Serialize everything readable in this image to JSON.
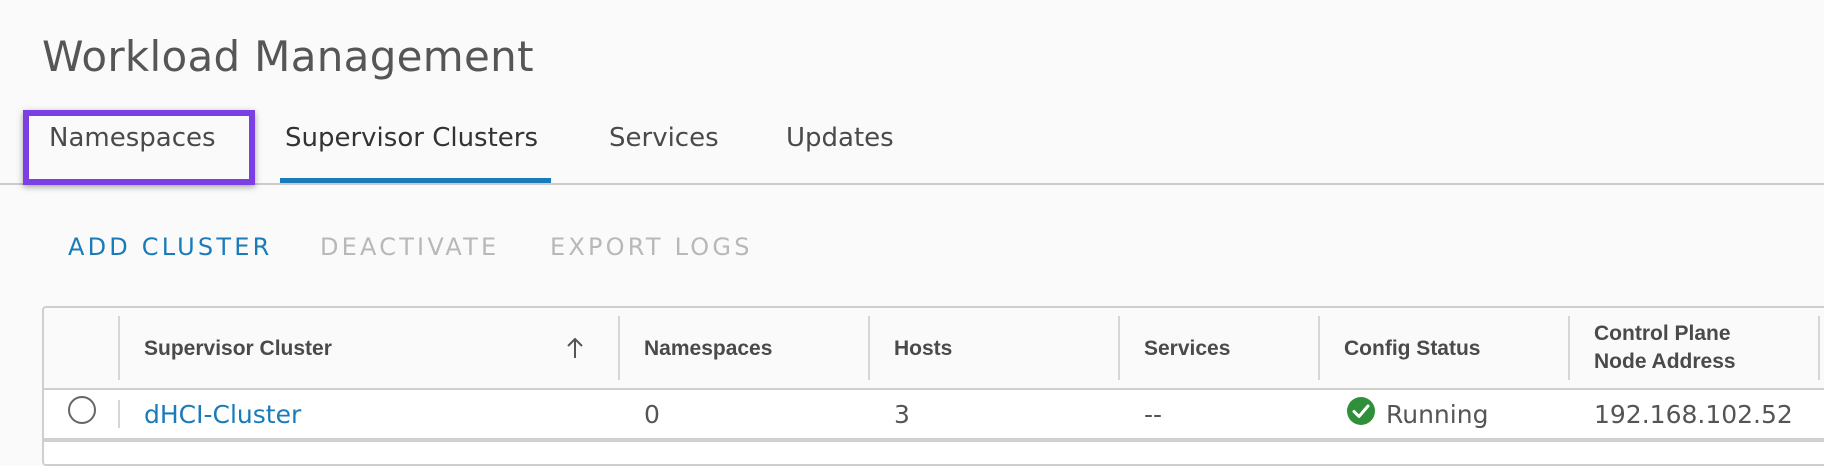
{
  "page": {
    "title": "Workload Management"
  },
  "tabs": [
    {
      "label": "Namespaces",
      "active": false,
      "highlighted": true
    },
    {
      "label": "Supervisor Clusters",
      "active": true
    },
    {
      "label": "Services",
      "active": false
    },
    {
      "label": "Updates",
      "active": false
    }
  ],
  "toolbar": {
    "add_cluster": "ADD CLUSTER",
    "deactivate": "DEACTIVATE",
    "export_logs": "EXPORT LOGS"
  },
  "table": {
    "columns": {
      "supervisor_cluster": "Supervisor Cluster",
      "namespaces": "Namespaces",
      "hosts": "Hosts",
      "services": "Services",
      "config_status": "Config Status",
      "control_plane_line1": "Control Plane",
      "control_plane_line2": "Node Address"
    },
    "sort": {
      "column": "Supervisor Cluster",
      "direction": "ascending",
      "icon": "arrow-up-icon"
    },
    "rows": [
      {
        "supervisor_cluster": "dHCI-Cluster",
        "namespaces": "0",
        "hosts": "3",
        "services": "--",
        "config_status": "Running",
        "status_icon": "check-circle-icon",
        "control_plane_address": "192.168.102.52",
        "selected": false
      }
    ]
  },
  "colors": {
    "accent": "#1a7bb9",
    "highlight": "#7b3fe4",
    "status_ok": "#2f8f3a",
    "disabled": "#b8b8b8"
  }
}
